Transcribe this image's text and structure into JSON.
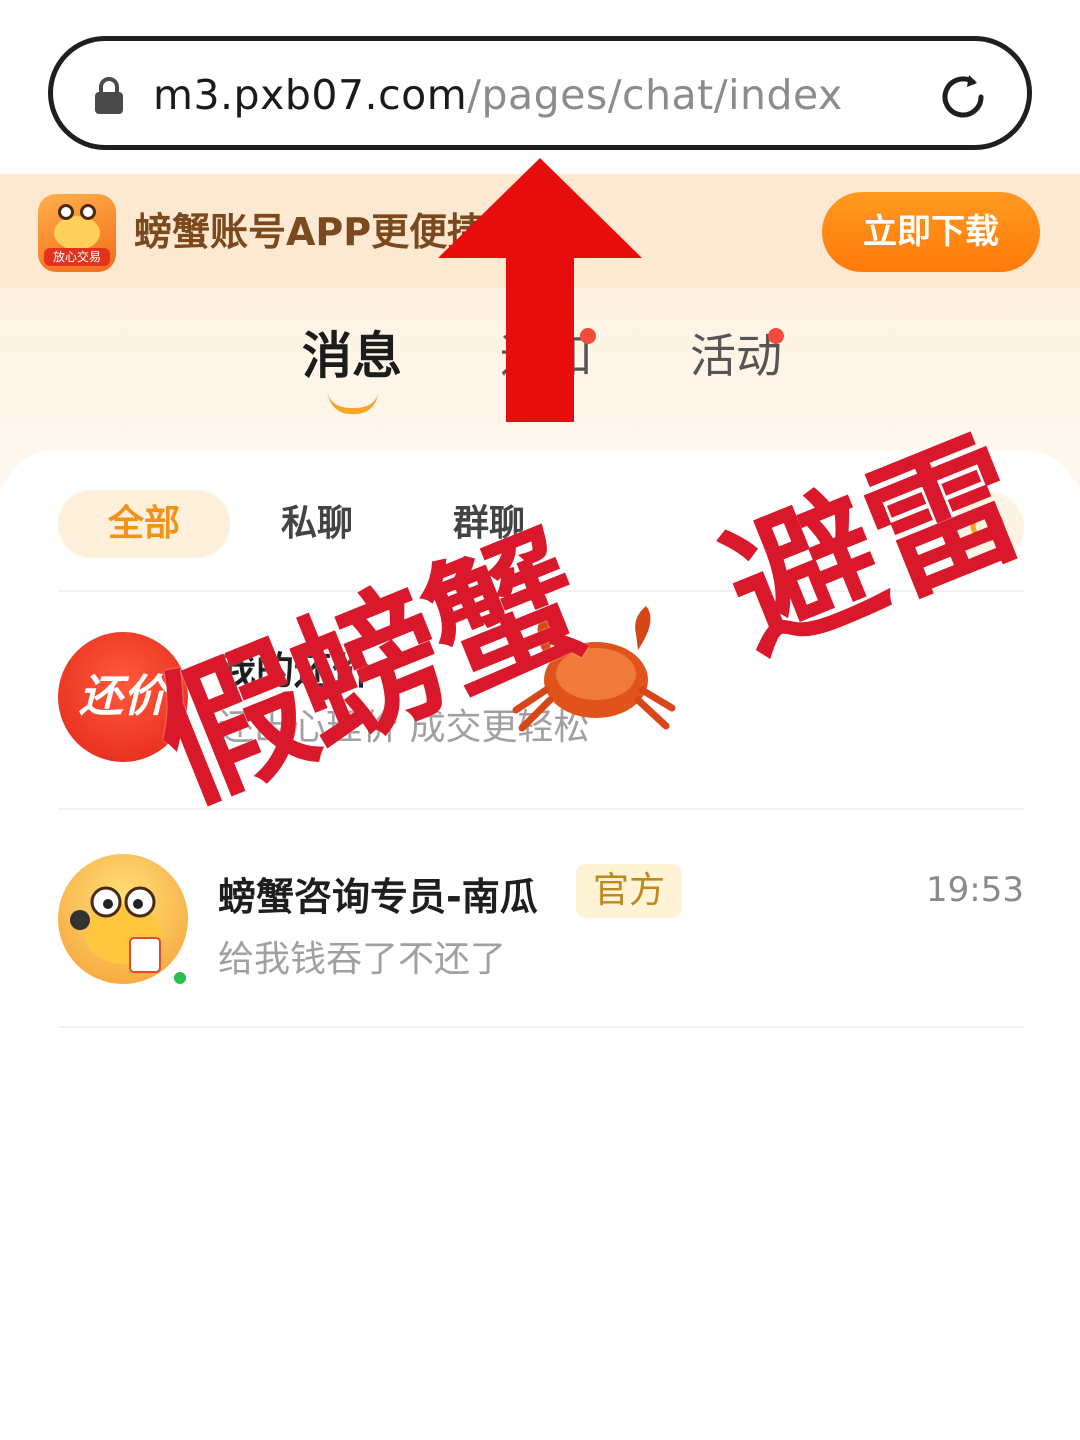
{
  "browser": {
    "url_host": "m3.pxb07.com",
    "url_path": "/pages/chat/index"
  },
  "banner": {
    "text": "螃蟹账号APP更便捷",
    "download_label": "立即下载",
    "icon_tag": "放心交易"
  },
  "main_tabs": [
    {
      "label": "消息",
      "active": true
    },
    {
      "label": "通知",
      "active": false,
      "dot": true
    },
    {
      "label": "活动",
      "active": false,
      "dot": true
    }
  ],
  "sub_tabs": [
    {
      "label": "全部",
      "active": true
    },
    {
      "label": "私聊",
      "active": false
    },
    {
      "label": "群聊",
      "active": false
    }
  ],
  "conversations": [
    {
      "avatar_text": "还价",
      "title": "我的还价",
      "subtitle": "还出心理价 成交更轻松"
    },
    {
      "title": "螃蟹咨询专员-南瓜",
      "badge": "官方",
      "time": "19:53",
      "subtitle": "给我钱吞了不还了",
      "online": true
    }
  ],
  "annotations": {
    "left_stamp": "假螃蟹",
    "right_stamp": "避雷",
    "color": "#d9182b"
  },
  "colors": {
    "accent_orange": "#ff8a16",
    "banner_bg": "#fde8d2",
    "arrow_red": "#e80d0d"
  }
}
